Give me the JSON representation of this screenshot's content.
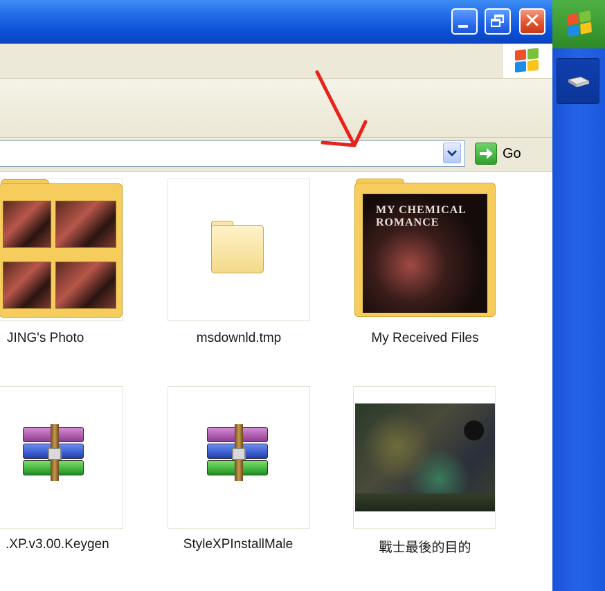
{
  "window": {
    "minimize_icon": "minimize-icon",
    "maximize_icon": "restore-icon",
    "close_icon": "close-icon",
    "close_glyph": "✕"
  },
  "address_bar": {
    "value": "",
    "dropdown_icon": "chevron-down-icon",
    "go_label": "Go",
    "go_icon": "go-arrow-icon"
  },
  "files": [
    {
      "name": "JING's Photo",
      "type": "folder-with-photos"
    },
    {
      "name": "msdownld.tmp",
      "type": "folder"
    },
    {
      "name": "My Received Files",
      "type": "folder-with-album-art",
      "album_text": "MY CHEMICAL ROMANCE"
    },
    {
      "name": ".XP.v3.00.Keygen",
      "type": "winrar-archive"
    },
    {
      "name": "StyleXPInstallMale",
      "type": "winrar-archive"
    },
    {
      "name": "戰士最後的目的",
      "type": "image"
    }
  ],
  "annotation": {
    "type": "red-arrow",
    "color": "#e8221a"
  },
  "colors": {
    "titlebar": "#0a4fd6",
    "chrome": "#ece9d8",
    "side_panel": "#2463e8",
    "go_green": "#2fa12c"
  }
}
